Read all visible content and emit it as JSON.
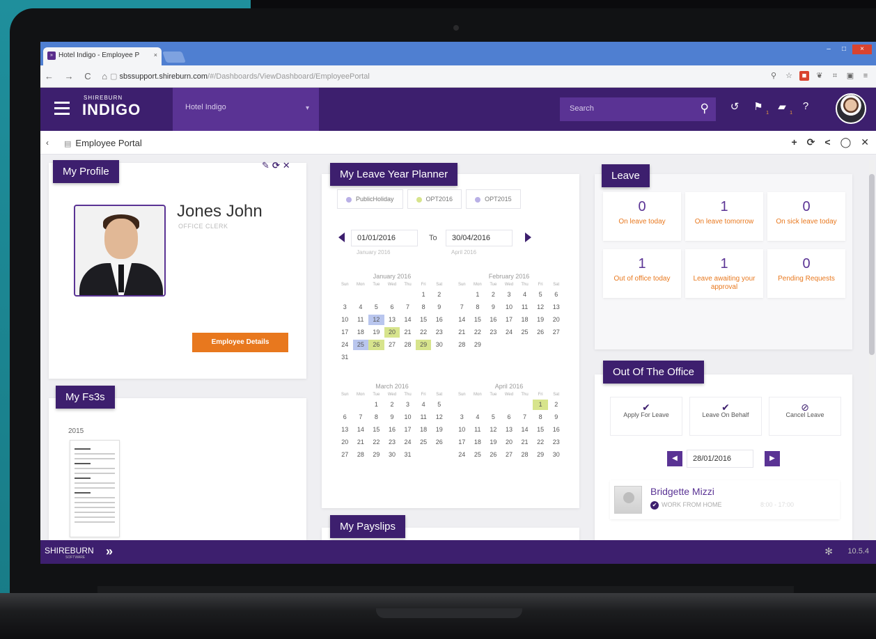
{
  "browser": {
    "tab_title": "Hotel Indigo - Employee P",
    "tab_close": "×",
    "nav_buttons": "← → C ⌂",
    "url_host": "sbssupport.shireburn.com",
    "url_path": "/#/Dashboards/ViewDashboard/EmployeePortal",
    "window_controls": [
      "–",
      "□",
      "×"
    ]
  },
  "header": {
    "brand_small": "SHIREBURN",
    "brand_name": "INDIGO",
    "hotel": "Hotel Indigo",
    "search_placeholder": "Search",
    "badges": {
      "tasks": "1",
      "messages": "1"
    }
  },
  "subheader": {
    "back": "‹",
    "title": "Employee Portal",
    "actions": [
      "+",
      "⟳",
      "<",
      "◯",
      "✕"
    ]
  },
  "profile": {
    "title": "My Profile",
    "tools": "✎⟳✕",
    "name": "Jones John",
    "role": "OFFICE CLERK",
    "details_button": "Employee Details"
  },
  "fs3": {
    "title": "My Fs3s",
    "year": "2015"
  },
  "planner": {
    "title": "My Leave Year Planner",
    "legend": [
      {
        "label": "PublicHoliday",
        "color": "#b9b0e6"
      },
      {
        "label": "OPT2016",
        "color": "#d7e48c"
      },
      {
        "label": "OPT2015",
        "color": "#b9b0e6"
      }
    ],
    "from_date": "01/01/2016",
    "from_sub": "January 2016",
    "to_label": "To",
    "to_date": "30/04/2016",
    "to_sub": "April 2016",
    "weekdays": [
      "Sun",
      "Mon",
      "Tue",
      "Wed",
      "Thu",
      "Fri",
      "Sat"
    ],
    "months": [
      {
        "name": "January 2016",
        "offset": 5,
        "days": 31,
        "green": [
          20,
          26,
          29
        ],
        "blue": [
          12,
          25
        ]
      },
      {
        "name": "February 2016",
        "offset": 1,
        "days": 29,
        "green": [],
        "blue": []
      },
      {
        "name": "March 2016",
        "offset": 2,
        "days": 31,
        "green": [],
        "blue": []
      },
      {
        "name": "April 2016",
        "offset": 5,
        "days": 30,
        "green": [
          1
        ],
        "blue": []
      }
    ]
  },
  "payslips": {
    "title": "My Payslips"
  },
  "leave": {
    "title": "Leave",
    "stats": [
      {
        "value": "0",
        "label": "On leave today"
      },
      {
        "value": "1",
        "label": "On leave tomorrow"
      },
      {
        "value": "0",
        "label": "On sick leave today"
      },
      {
        "value": "1",
        "label": "Out of office today"
      },
      {
        "value": "1",
        "label": "Leave awaiting your approval"
      },
      {
        "value": "0",
        "label": "Pending Requests"
      }
    ]
  },
  "out_of_office": {
    "title": "Out Of The Office",
    "buttons": [
      {
        "icon": "✔",
        "label": "Apply For Leave"
      },
      {
        "icon": "✔",
        "label": "Leave On Behalf"
      },
      {
        "icon": "⊘",
        "label": "Cancel Leave"
      }
    ],
    "date": "28/01/2016",
    "person": {
      "name": "Bridgette Mizzi",
      "status": "WORK FROM HOME",
      "time": "8:00 - 17:00"
    }
  },
  "footer": {
    "logo": "SHIREBURN",
    "logo_sub": "SOFTWARE",
    "version": "10.5.4"
  },
  "colors": {
    "brand": "#3d1f6e",
    "accent": "#5a3394",
    "orange": "#e8781e"
  }
}
